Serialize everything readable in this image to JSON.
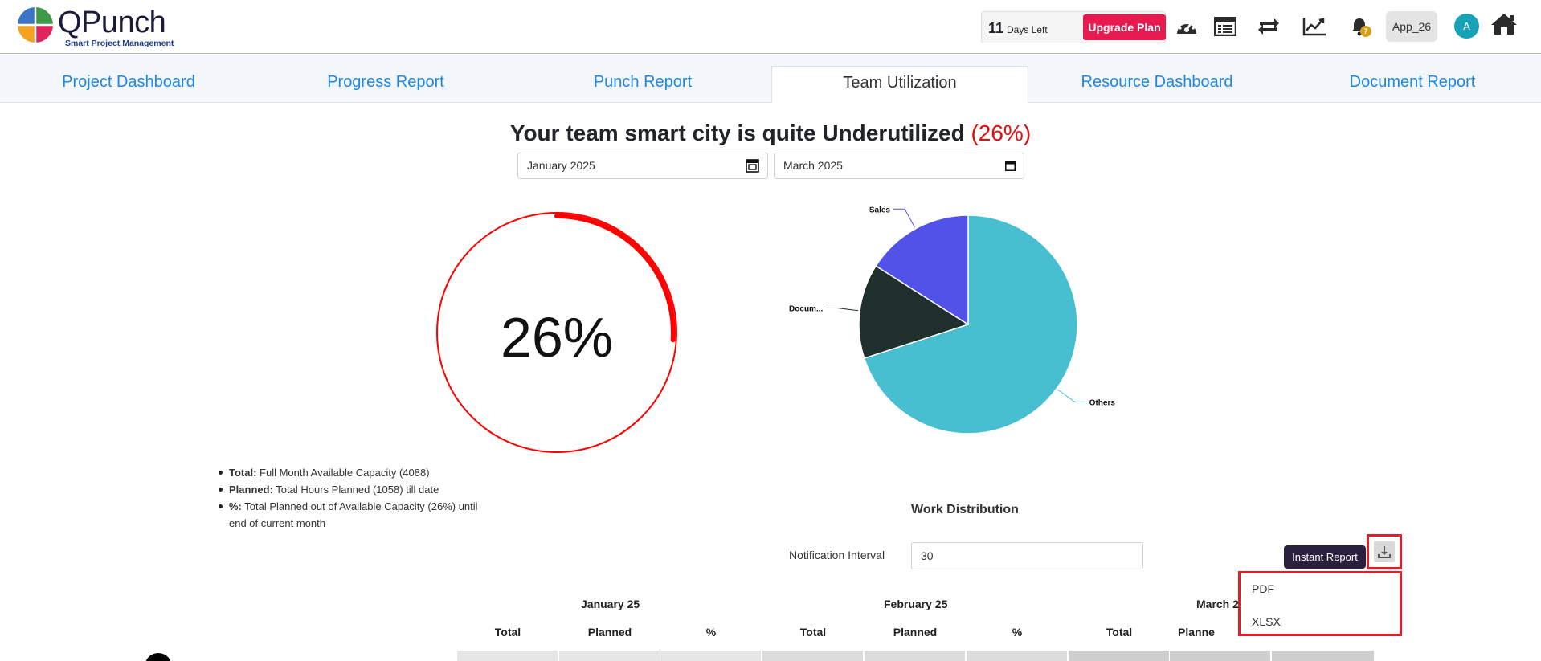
{
  "header": {
    "logo_name": "QPunch",
    "logo_tagline": "Smart Project Management",
    "days_count": "11",
    "days_text": "Days Left",
    "upgrade_label": "Upgrade Plan",
    "notification_count": "7",
    "app_label": "App_26",
    "avatar_initial": "A",
    "icons": [
      "dashboard-gauge-icon",
      "list-icon",
      "sync-icon",
      "trend-chart-icon",
      "bell-icon",
      "home-icon"
    ]
  },
  "tabs": [
    {
      "label": "Project Dashboard"
    },
    {
      "label": "Progress Report"
    },
    {
      "label": "Punch Report"
    },
    {
      "label": "Team Utilization",
      "active": true
    },
    {
      "label": "Resource Dashboard"
    },
    {
      "label": "Document Report"
    }
  ],
  "heading": {
    "text": "Your team smart city is quite Underutilized",
    "percent": "(26%)"
  },
  "date_range": {
    "from": "January  2025",
    "to": "March  2025"
  },
  "gauge": {
    "label": "26%",
    "value": 0.26,
    "color": "#ff0000"
  },
  "pie": {
    "slices": [
      {
        "label": "Others",
        "value": 70,
        "color": "#47bfd1"
      },
      {
        "label": "Docum...",
        "value": 14,
        "color": "#1f2f2b"
      },
      {
        "label": "Sales",
        "value": 16,
        "color": "#5352e8"
      }
    ]
  },
  "legend": {
    "total_key": "Total:",
    "total_text": "Full Month Available Capacity (4088)",
    "planned_key": "Planned:",
    "planned_text": "Total Hours Planned (1058) till date",
    "pct_key": "%:",
    "pct_text": "Total Planned out of Available Capacity (26%) until end of current month"
  },
  "work_distribution": {
    "title": "Work Distribution",
    "notif_label": "Notification Interval",
    "notif_value": "30",
    "instant_label": "Instant Report",
    "download_icon": "download-icon",
    "dropdown_items": [
      "PDF",
      "XLSX"
    ]
  },
  "table": {
    "months": [
      "January 25",
      "February 25",
      "March 2"
    ],
    "columns": [
      "Total",
      "Planned",
      "%",
      "Total",
      "Planned",
      "%",
      "Total",
      "Planne"
    ]
  },
  "colors": {
    "accent_blue": "#1e88e5",
    "upgrade_red": "#e8194f",
    "alert_red": "#e30b0b",
    "highlight_border": "#e21f26"
  }
}
